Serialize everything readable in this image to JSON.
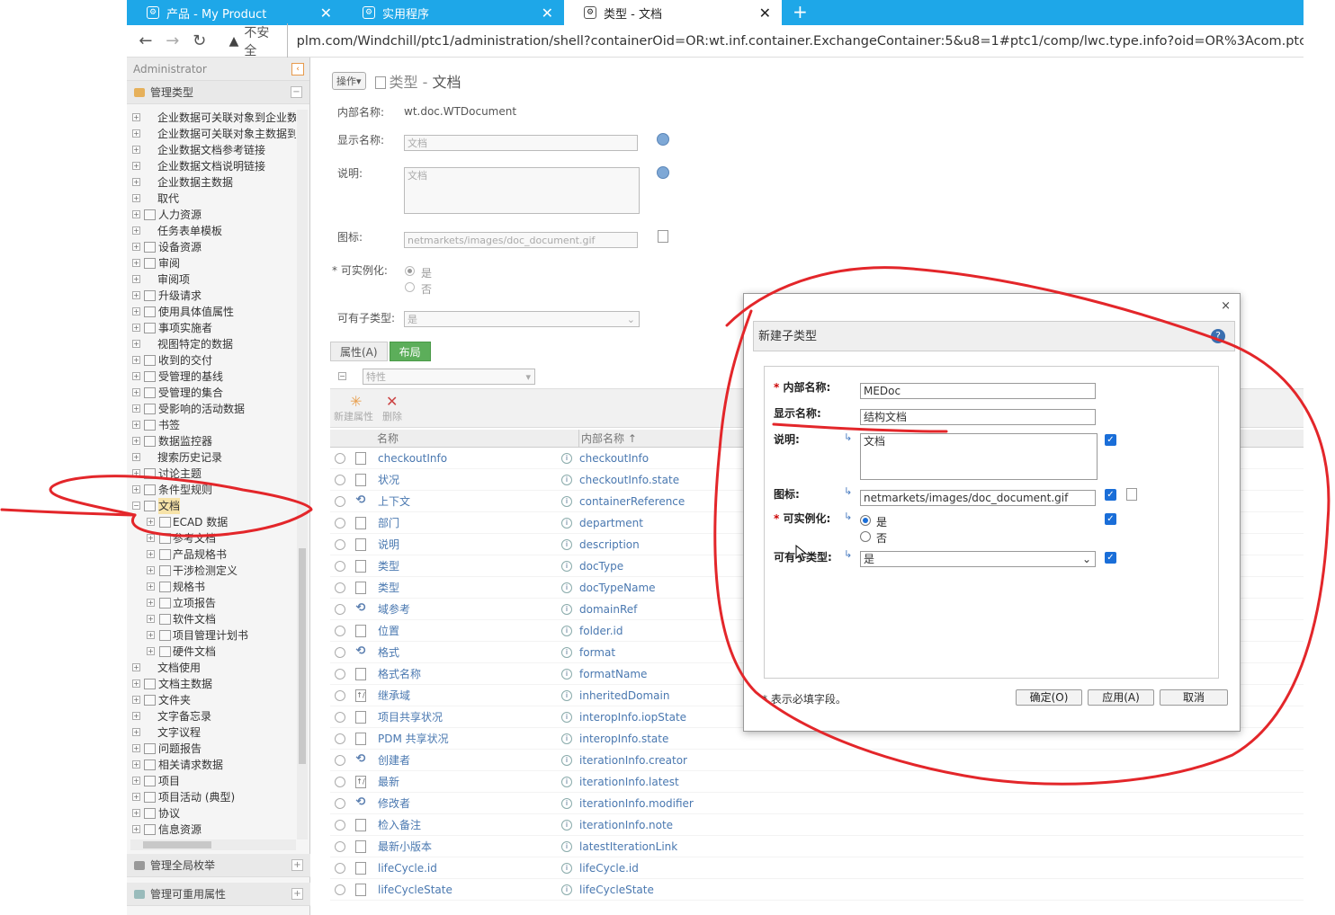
{
  "browser": {
    "tabs": [
      {
        "label": "产品 - My Product"
      },
      {
        "label": "实用程序"
      },
      {
        "label": "类型 - 文档"
      }
    ],
    "new_tab": "+",
    "security": "不安全",
    "url": "plm.com/Windchill/ptc1/administration/shell?containerOid=OR:wt.inf.container.ExchangeContainer:5&u8=1#ptc1/comp/lwc.type.info?oid=OR%3Acom.ptc.core.lwc.s"
  },
  "sidebar": {
    "title": "Administrator",
    "section": "管理类型",
    "tree": [
      "企业数据可关联对象到企业数",
      "企业数据可关联对象主数据到",
      "企业数据文档参考链接",
      "企业数据文档说明链接",
      "企业数据主数据",
      "取代",
      "人力资源",
      "任务表单模板",
      "设备资源",
      "审阅",
      "审阅项",
      "升级请求",
      "使用具体值属性",
      "事项实施者",
      "视图特定的数据",
      "收到的交付",
      "受管理的基线",
      "受管理的集合",
      "受影响的活动数据",
      "书签",
      "数据监控器",
      "搜索历史记录",
      "讨论主题",
      "条件型规则",
      "文档",
      "ECAD 数据",
      "参考文档",
      "产品规格书",
      "干涉检测定义",
      "规格书",
      "立项报告",
      "软件文档",
      "项目管理计划书",
      "硬件文档",
      "文档使用",
      "文档主数据",
      "文件夹",
      "文字备忘录",
      "文字议程",
      "问题报告",
      "相关请求数据",
      "项目",
      "项目活动 (典型)",
      "协议",
      "信息资源"
    ],
    "bottom_sections": [
      "管理全局枚举",
      "管理可重用属性"
    ]
  },
  "page": {
    "ops_label": "操作",
    "title_prefix": "类型 - ",
    "title_name": "文档",
    "internal_name_label": "内部名称:",
    "internal_name": "wt.doc.WTDocument",
    "display_name_label": "显示名称:",
    "display_name": "文档",
    "description_label": "说明:",
    "description": "文档",
    "icon_label": "图标:",
    "icon": "netmarkets/images/doc_document.gif",
    "instantiable_label": "可实例化:",
    "yes": "是",
    "no": "否",
    "subtypes_label": "可有子类型:",
    "subtypes_value": "是",
    "tab_attrs": "属性(A)",
    "tab_layout": "布局",
    "filter": "特性",
    "new_attr": "新建属性",
    "delete": "删除",
    "col_name": "名称",
    "col_internal": "内部名称 ↑"
  },
  "attributes": [
    {
      "name": "checkoutInfo",
      "internal": "checkoutInfo"
    },
    {
      "name": "状况",
      "internal": "checkoutInfo.state"
    },
    {
      "name": "上下文",
      "internal": "containerReference"
    },
    {
      "name": "部门",
      "internal": "department"
    },
    {
      "name": "说明",
      "internal": "description"
    },
    {
      "name": "类型",
      "internal": "docType"
    },
    {
      "name": "类型",
      "internal": "docTypeName"
    },
    {
      "name": "域参考",
      "internal": "domainRef"
    },
    {
      "name": "位置",
      "internal": "folder.id"
    },
    {
      "name": "格式",
      "internal": "format"
    },
    {
      "name": "格式名称",
      "internal": "formatName"
    },
    {
      "name": "继承域",
      "internal": "inheritedDomain"
    },
    {
      "name": "项目共享状况",
      "internal": "interopInfo.iopState"
    },
    {
      "name": "PDM 共享状况",
      "internal": "interopInfo.state"
    },
    {
      "name": "创建者",
      "internal": "iterationInfo.creator"
    },
    {
      "name": "最新",
      "internal": "iterationInfo.latest"
    },
    {
      "name": "修改者",
      "internal": "iterationInfo.modifier"
    },
    {
      "name": "检入备注",
      "internal": "iterationInfo.note"
    },
    {
      "name": "最新小版本",
      "internal": "latestIterationLink"
    },
    {
      "name": "lifeCycle.id",
      "internal": "lifeCycle.id"
    },
    {
      "name": "lifeCycleState",
      "internal": "lifeCycleState"
    }
  ],
  "dialog": {
    "title": "新建子类型",
    "close": "×",
    "help": "?",
    "internal_name_label": "内部名称:",
    "internal_name": "MEDoc",
    "display_name_label": "显示名称:",
    "display_name": "结构文档",
    "description_label": "说明:",
    "description": "文档",
    "icon_label": "图标:",
    "icon": "netmarkets/images/doc_document.gif",
    "instantiable_label": "可实例化:",
    "yes": "是",
    "no": "否",
    "subtypes_label": "可有子类型:",
    "subtypes_value": "是",
    "required_note": "* 表示必填字段。",
    "ok": "确定(O)",
    "apply": "应用(A)",
    "cancel": "取消",
    "required_mark": "*"
  },
  "colors": {
    "tab_strip": "#1ea7e8",
    "annotation_ink": "#e3262a",
    "accent_check": "#1a6ed8"
  }
}
